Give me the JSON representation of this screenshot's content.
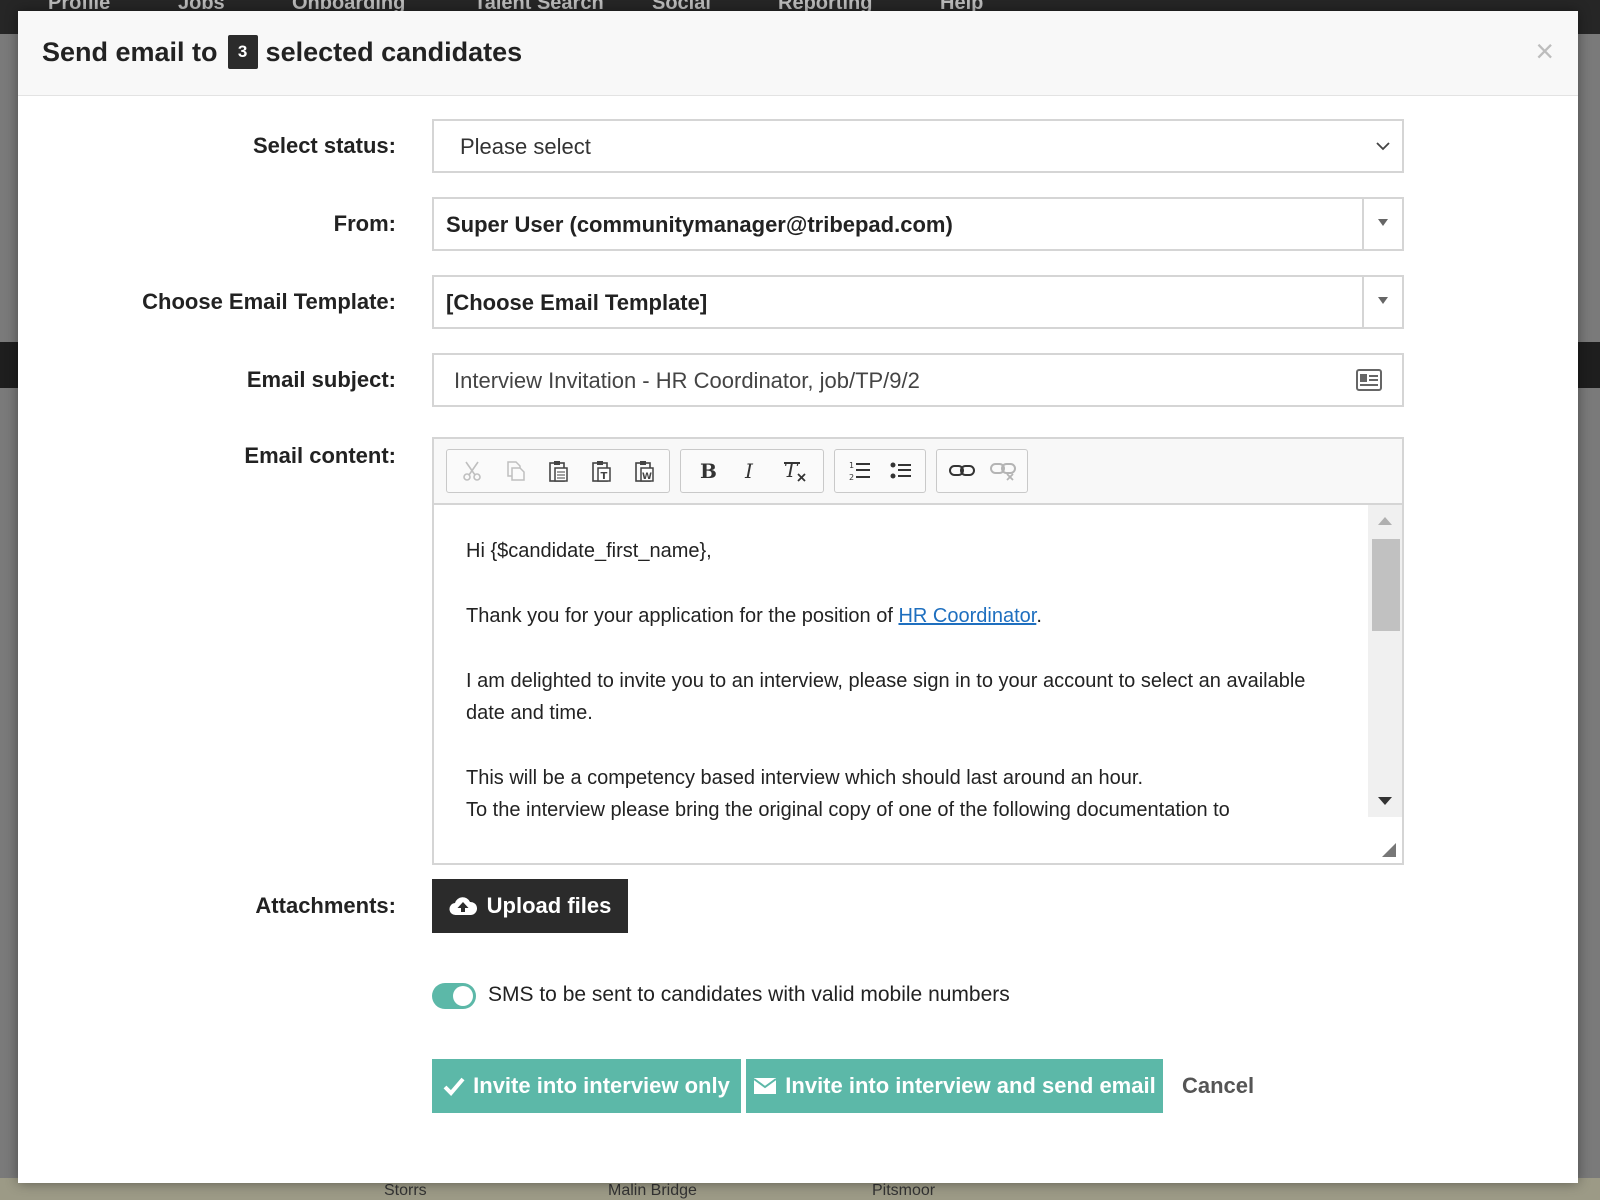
{
  "background_app": {
    "nav_items": [
      "Profile",
      "Jobs",
      "Onboarding",
      "Talent Search",
      "Social",
      "Reporting",
      "Help"
    ],
    "map_labels": [
      "Storrs",
      "Malin Bridge",
      "Pitsmoor"
    ]
  },
  "modal": {
    "title_prefix": "Send email to",
    "selected_count": "3",
    "title_suffix": "selected candidates",
    "close_label": "×"
  },
  "form": {
    "status": {
      "label": "Select status:",
      "value": "Please select"
    },
    "from": {
      "label": "From:",
      "value": "Super User (communitymanager@tribepad.com)"
    },
    "template": {
      "label": "Choose Email Template:",
      "value": "[Choose Email Template]"
    },
    "subject": {
      "label": "Email subject:",
      "value": "Interview Invitation - HR Coordinator, job/TP/9/2"
    },
    "content": {
      "label": "Email content:",
      "toolbar_icons": [
        "cut-icon",
        "copy-icon",
        "paste-icon",
        "paste-text-icon",
        "paste-word-icon",
        "bold-icon",
        "italic-icon",
        "remove-format-icon",
        "numbered-list-icon",
        "bulleted-list-icon",
        "link-icon",
        "unlink-icon"
      ],
      "greeting": "Hi {$candidate_first_name},",
      "line1_before_link": "Thank you for your application for the position of",
      "line1_link": "HR Coordinator",
      "line1_after_link": ".",
      "line2a": "I am delighted to invite you to an interview, please sign in to your account to select an available",
      "line2b": "date and time.",
      "line3": "This will be a competency based interview which should last around an hour.",
      "line4": "To the interview please bring the original copy of one of the following documentation to"
    },
    "attachments": {
      "label": "Attachments:",
      "upload_label": "Upload files"
    },
    "sms_toggle": {
      "label": "SMS to be sent to candidates with valid mobile numbers",
      "enabled": true
    }
  },
  "actions": {
    "invite_only_label": "Invite into interview only",
    "invite_and_email_label": "Invite into interview and send email",
    "cancel_label": "Cancel"
  },
  "colors": {
    "accent": "#5cb8a8",
    "dark_button": "#2b2b2b",
    "link": "#1e6fbf"
  }
}
